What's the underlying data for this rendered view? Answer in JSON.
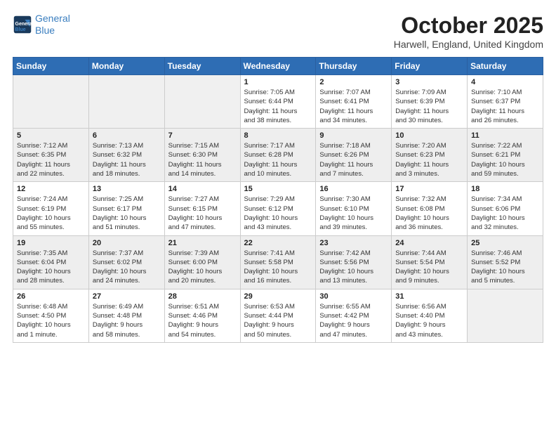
{
  "header": {
    "logo_line1": "General",
    "logo_line2": "Blue",
    "month": "October 2025",
    "location": "Harwell, England, United Kingdom"
  },
  "weekdays": [
    "Sunday",
    "Monday",
    "Tuesday",
    "Wednesday",
    "Thursday",
    "Friday",
    "Saturday"
  ],
  "weeks": [
    [
      {
        "day": "",
        "info": ""
      },
      {
        "day": "",
        "info": ""
      },
      {
        "day": "",
        "info": ""
      },
      {
        "day": "1",
        "info": "Sunrise: 7:05 AM\nSunset: 6:44 PM\nDaylight: 11 hours\nand 38 minutes."
      },
      {
        "day": "2",
        "info": "Sunrise: 7:07 AM\nSunset: 6:41 PM\nDaylight: 11 hours\nand 34 minutes."
      },
      {
        "day": "3",
        "info": "Sunrise: 7:09 AM\nSunset: 6:39 PM\nDaylight: 11 hours\nand 30 minutes."
      },
      {
        "day": "4",
        "info": "Sunrise: 7:10 AM\nSunset: 6:37 PM\nDaylight: 11 hours\nand 26 minutes."
      }
    ],
    [
      {
        "day": "5",
        "info": "Sunrise: 7:12 AM\nSunset: 6:35 PM\nDaylight: 11 hours\nand 22 minutes."
      },
      {
        "day": "6",
        "info": "Sunrise: 7:13 AM\nSunset: 6:32 PM\nDaylight: 11 hours\nand 18 minutes."
      },
      {
        "day": "7",
        "info": "Sunrise: 7:15 AM\nSunset: 6:30 PM\nDaylight: 11 hours\nand 14 minutes."
      },
      {
        "day": "8",
        "info": "Sunrise: 7:17 AM\nSunset: 6:28 PM\nDaylight: 11 hours\nand 10 minutes."
      },
      {
        "day": "9",
        "info": "Sunrise: 7:18 AM\nSunset: 6:26 PM\nDaylight: 11 hours\nand 7 minutes."
      },
      {
        "day": "10",
        "info": "Sunrise: 7:20 AM\nSunset: 6:23 PM\nDaylight: 11 hours\nand 3 minutes."
      },
      {
        "day": "11",
        "info": "Sunrise: 7:22 AM\nSunset: 6:21 PM\nDaylight: 10 hours\nand 59 minutes."
      }
    ],
    [
      {
        "day": "12",
        "info": "Sunrise: 7:24 AM\nSunset: 6:19 PM\nDaylight: 10 hours\nand 55 minutes."
      },
      {
        "day": "13",
        "info": "Sunrise: 7:25 AM\nSunset: 6:17 PM\nDaylight: 10 hours\nand 51 minutes."
      },
      {
        "day": "14",
        "info": "Sunrise: 7:27 AM\nSunset: 6:15 PM\nDaylight: 10 hours\nand 47 minutes."
      },
      {
        "day": "15",
        "info": "Sunrise: 7:29 AM\nSunset: 6:12 PM\nDaylight: 10 hours\nand 43 minutes."
      },
      {
        "day": "16",
        "info": "Sunrise: 7:30 AM\nSunset: 6:10 PM\nDaylight: 10 hours\nand 39 minutes."
      },
      {
        "day": "17",
        "info": "Sunrise: 7:32 AM\nSunset: 6:08 PM\nDaylight: 10 hours\nand 36 minutes."
      },
      {
        "day": "18",
        "info": "Sunrise: 7:34 AM\nSunset: 6:06 PM\nDaylight: 10 hours\nand 32 minutes."
      }
    ],
    [
      {
        "day": "19",
        "info": "Sunrise: 7:35 AM\nSunset: 6:04 PM\nDaylight: 10 hours\nand 28 minutes."
      },
      {
        "day": "20",
        "info": "Sunrise: 7:37 AM\nSunset: 6:02 PM\nDaylight: 10 hours\nand 24 minutes."
      },
      {
        "day": "21",
        "info": "Sunrise: 7:39 AM\nSunset: 6:00 PM\nDaylight: 10 hours\nand 20 minutes."
      },
      {
        "day": "22",
        "info": "Sunrise: 7:41 AM\nSunset: 5:58 PM\nDaylight: 10 hours\nand 16 minutes."
      },
      {
        "day": "23",
        "info": "Sunrise: 7:42 AM\nSunset: 5:56 PM\nDaylight: 10 hours\nand 13 minutes."
      },
      {
        "day": "24",
        "info": "Sunrise: 7:44 AM\nSunset: 5:54 PM\nDaylight: 10 hours\nand 9 minutes."
      },
      {
        "day": "25",
        "info": "Sunrise: 7:46 AM\nSunset: 5:52 PM\nDaylight: 10 hours\nand 5 minutes."
      }
    ],
    [
      {
        "day": "26",
        "info": "Sunrise: 6:48 AM\nSunset: 4:50 PM\nDaylight: 10 hours\nand 1 minute."
      },
      {
        "day": "27",
        "info": "Sunrise: 6:49 AM\nSunset: 4:48 PM\nDaylight: 9 hours\nand 58 minutes."
      },
      {
        "day": "28",
        "info": "Sunrise: 6:51 AM\nSunset: 4:46 PM\nDaylight: 9 hours\nand 54 minutes."
      },
      {
        "day": "29",
        "info": "Sunrise: 6:53 AM\nSunset: 4:44 PM\nDaylight: 9 hours\nand 50 minutes."
      },
      {
        "day": "30",
        "info": "Sunrise: 6:55 AM\nSunset: 4:42 PM\nDaylight: 9 hours\nand 47 minutes."
      },
      {
        "day": "31",
        "info": "Sunrise: 6:56 AM\nSunset: 4:40 PM\nDaylight: 9 hours\nand 43 minutes."
      },
      {
        "day": "",
        "info": ""
      }
    ]
  ]
}
